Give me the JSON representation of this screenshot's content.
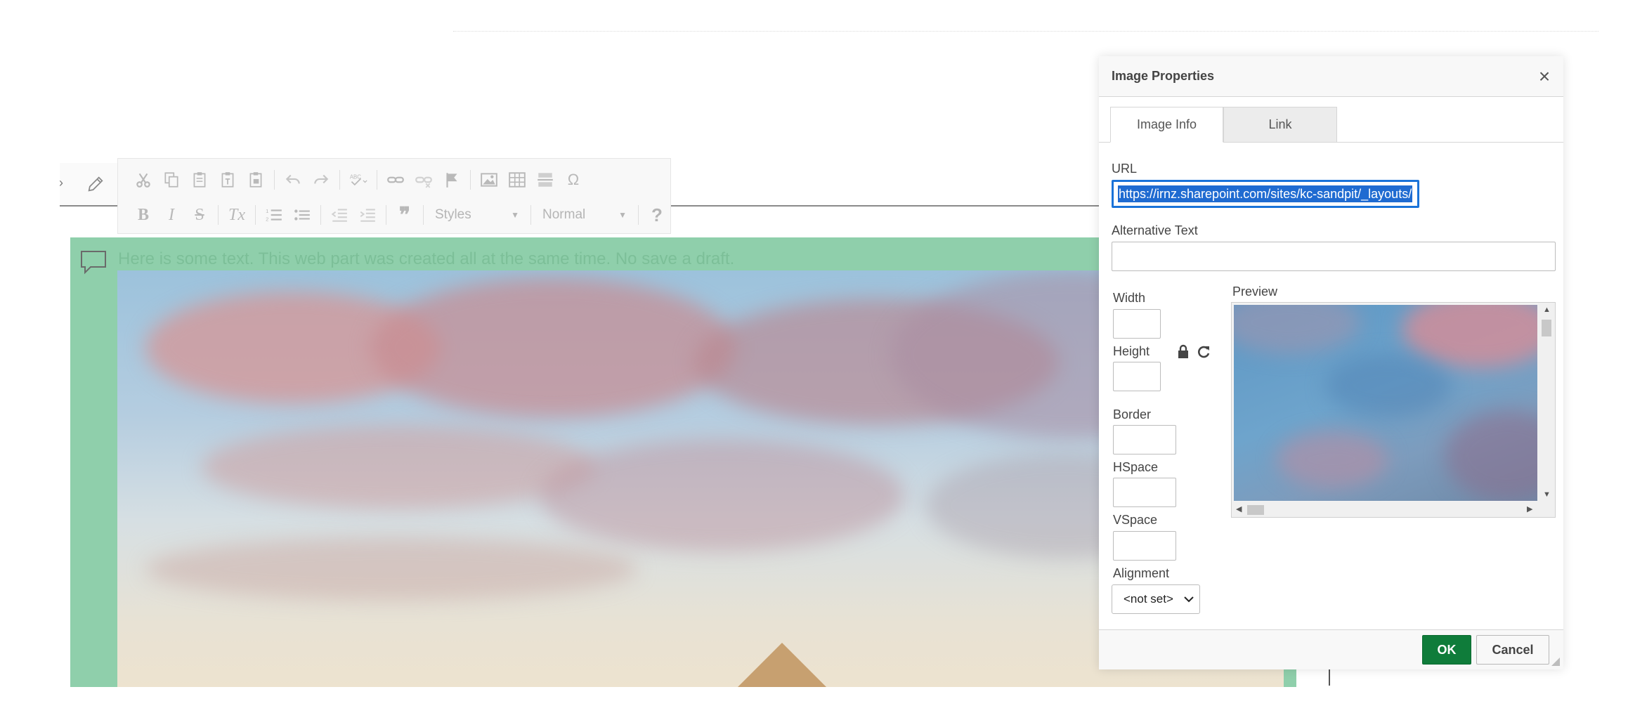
{
  "editor": {
    "toolbar": {
      "row1": [
        "cut-icon",
        "copy-icon",
        "paste-icon",
        "paste-text-icon",
        "paste-word-icon",
        "undo-icon",
        "redo-icon",
        "spellcheck-icon",
        "link-icon",
        "unlink-icon",
        "anchor-flag-icon",
        "image-icon",
        "table-icon",
        "horizontal-rule-icon",
        "special-char-icon"
      ],
      "special_char_glyph": "Ω",
      "bold_glyph": "B",
      "italic_glyph": "I",
      "strike_glyph": "S",
      "remove_format_glyph": "Tx",
      "blockquote_glyph": "❞",
      "styles_label": "Styles",
      "format_label": "Normal",
      "help_glyph": "?"
    },
    "webpart_text": "Here is some text. This web part was created all at the same time. No save a draft.",
    "webpart_color": "#8fcfab"
  },
  "dialog": {
    "title": "Image Properties",
    "close_glyph": "×",
    "tabs": [
      {
        "label": "Image Info",
        "active": true
      },
      {
        "label": "Link",
        "active": false
      }
    ],
    "url_label": "URL",
    "url_value": "https://irnz.sharepoint.com/sites/kc-sandpit/_layouts/",
    "alt_label": "Alternative Text",
    "alt_value": "",
    "width_label": "Width",
    "height_label": "Height",
    "border_label": "Border",
    "hspace_label": "HSpace",
    "vspace_label": "VSpace",
    "alignment_label": "Alignment",
    "alignment_value": "<not set>",
    "preview_label": "Preview",
    "ok_label": "OK",
    "cancel_label": "Cancel",
    "ok_color": "#0f7c3a",
    "focus_color": "#1a73d9"
  }
}
